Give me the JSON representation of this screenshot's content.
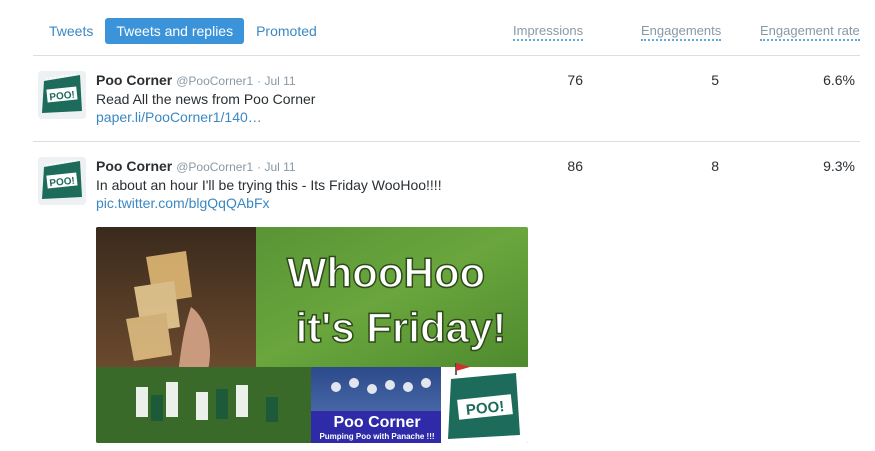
{
  "tabs": [
    "Tweets",
    "Tweets and replies",
    "Promoted"
  ],
  "columns": {
    "impressions": "Impressions",
    "engagements": "Engagements",
    "engagement_rate": "Engagement rate"
  },
  "tweets": [
    {
      "name": "Poo Corner",
      "handle": "@PooCorner1",
      "date": "· Jul 11",
      "text": "Read All the news from Poo Corner",
      "link": "paper.li/PooCorner1/140…",
      "impressions": "76",
      "engagements": "5",
      "rate": "6.6%"
    },
    {
      "name": "Poo Corner",
      "handle": "@PooCorner1",
      "date": "· Jul 11",
      "text": "In about an hour I'll be trying this - Its Friday WooHoo!!!!",
      "link": "pic.twitter.com/blgQqQAbFx",
      "impressions": "86",
      "engagements": "8",
      "rate": "9.3%"
    }
  ],
  "avatar_logo_text": "POO!",
  "media": {
    "headline_1": "WhooHoo",
    "headline_2": "it's Friday!",
    "banner_title": "Poo Corner",
    "banner_tagline": "Pumping Poo with Panache !!!",
    "logo_text": "POO!"
  },
  "colors": {
    "accent": "#3b94d9",
    "link": "#3b88c3",
    "muted": "#8899a6",
    "brand_green": "#1d6b5a"
  }
}
